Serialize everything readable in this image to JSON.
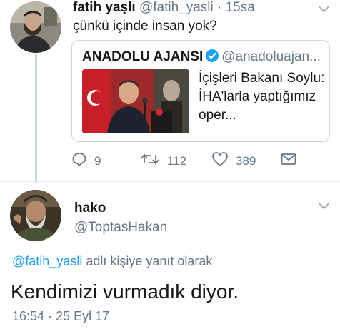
{
  "tweet1": {
    "name": "fatih yaşlı",
    "handle": "@fatih_yasli",
    "separator": "·",
    "time": "15sa",
    "text": "çünkü içinde insan yok?",
    "quote": {
      "name": "ANADOLU AJANSI",
      "handle": "@anadoluajan...",
      "text": "İçişleri Bakanı Soylu: İHA'larla yaptığımız oper..."
    },
    "actions": {
      "reply_icon": "reply-icon",
      "reply_count": "9",
      "retweet_icon": "retweet-icon",
      "retweet_count": "112",
      "like_icon": "heart-icon",
      "like_count": "389",
      "dm_icon": "envelope-icon"
    }
  },
  "tweet2": {
    "name": "hako",
    "handle": "@ToptasHakan",
    "reply_mention": "@fatih_yasli",
    "reply_suffix": " adlı kişiye yanıt olarak",
    "text": "Kendimizi vurmadık diyor.",
    "timestamp": "16:54 · 25 Eyl 17"
  },
  "colors": {
    "text": "#14171a",
    "secondary": "#657786",
    "link": "#1da1f2",
    "verified": "#1da1f2",
    "border": "#ccd6dd"
  }
}
